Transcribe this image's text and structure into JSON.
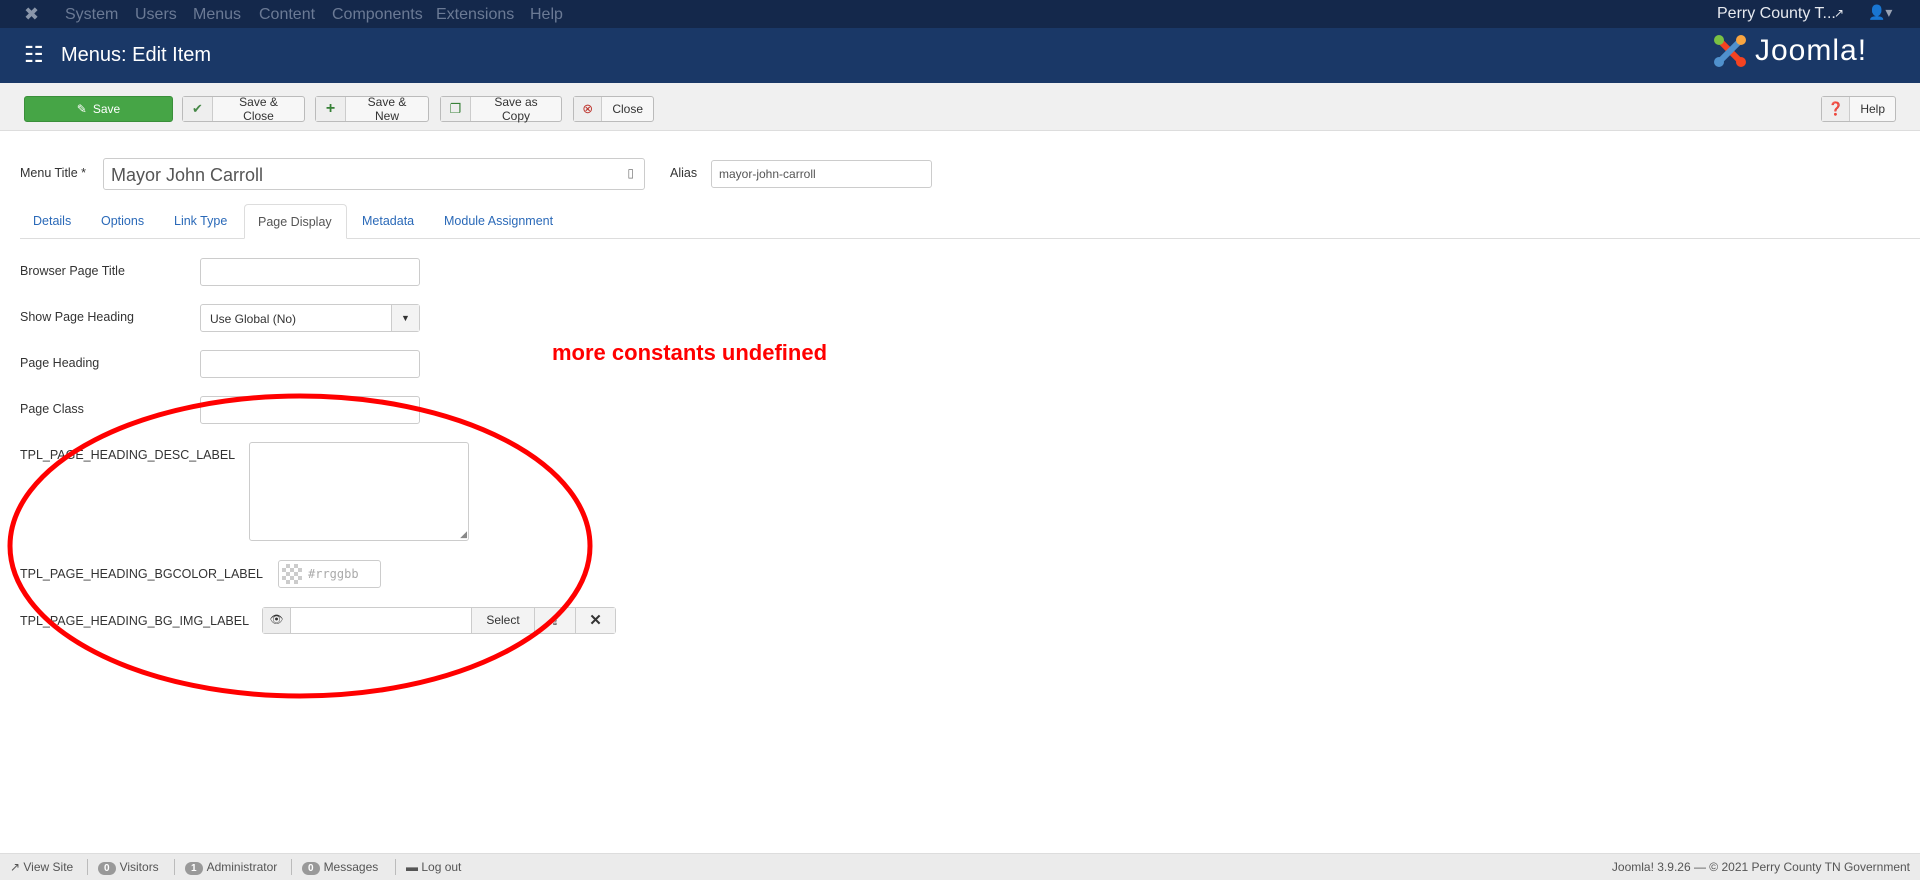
{
  "navbar": {
    "items": [
      "System",
      "Users",
      "Menus",
      "Content",
      "Components",
      "Extensions",
      "Help"
    ],
    "site_name": "Perry County T..."
  },
  "header": {
    "title": "Menus: Edit Item",
    "logo_text": "Joomla!"
  },
  "toolbar": {
    "save": "Save",
    "save_close": "Save & Close",
    "save_new": "Save & New",
    "save_copy": "Save as Copy",
    "close": "Close",
    "help": "Help"
  },
  "form": {
    "menu_title_label": "Menu Title *",
    "menu_title_value": "Mayor John Carroll",
    "alias_label": "Alias",
    "alias_value": "mayor-john-carroll"
  },
  "tabs": [
    "Details",
    "Options",
    "Link Type",
    "Page Display",
    "Metadata",
    "Module Assignment"
  ],
  "fields": {
    "browser_page_title": "Browser Page Title",
    "show_page_heading": "Show Page Heading",
    "show_page_heading_value": "Use Global (No)",
    "page_heading": "Page Heading",
    "page_class": "Page Class",
    "desc_label": "TPL_PAGE_HEADING_DESC_LABEL",
    "bgcolor_label": "TPL_PAGE_HEADING_BGCOLOR_LABEL",
    "bgcolor_placeholder": "#rrggbb",
    "bgimg_label": "TPL_PAGE_HEADING_BG_IMG_LABEL",
    "select": "Select"
  },
  "annotation": {
    "text": "more constants undefined",
    "color": "#ff0000"
  },
  "footer": {
    "view_site": "View Site",
    "visitors_count": "0",
    "visitors": "Visitors",
    "admin_count": "1",
    "admin": "Administrator",
    "messages_count": "0",
    "messages": "Messages",
    "logout": "Log out",
    "copyright": "Joomla! 3.9.26  —  © 2021 Perry County TN Government"
  }
}
